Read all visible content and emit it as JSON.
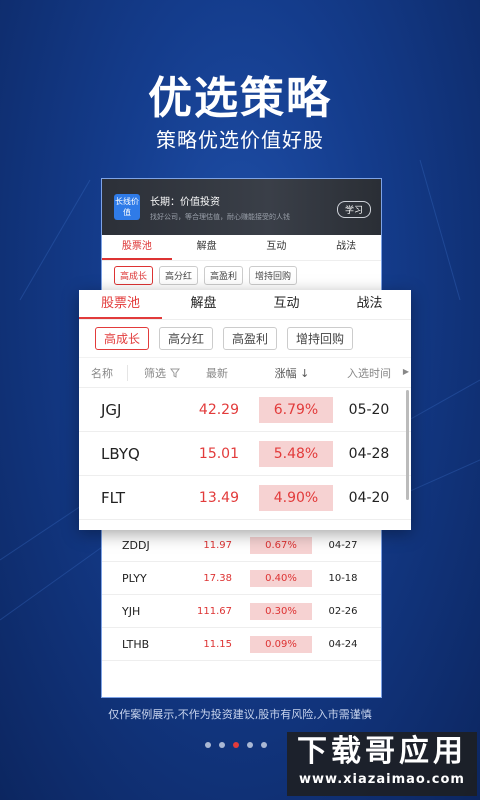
{
  "hero": {
    "title": "优选策略",
    "subtitle": "策略优选价值好股"
  },
  "banner": {
    "logo_text": "长线价值",
    "title": "长期：价值投资",
    "subtitle": "找好公司，等合理估值，耐心赚能接受的人钱",
    "button": "学习"
  },
  "tabs": [
    "股票池",
    "解盘",
    "互动",
    "战法"
  ],
  "chips": [
    "高成长",
    "高分红",
    "高盈利",
    "增持回购"
  ],
  "table": {
    "headers": {
      "name": "名称",
      "filter": "筛选",
      "price": "最新",
      "change": "涨幅",
      "date": "入选时间"
    },
    "rows": [
      {
        "code": "JGJ",
        "price": "42.29",
        "change": "6.79%",
        "date": "05-20"
      },
      {
        "code": "LBYQ",
        "price": "15.01",
        "change": "5.48%",
        "date": "04-28"
      },
      {
        "code": "FLT",
        "price": "13.49",
        "change": "4.90%",
        "date": "04-20"
      }
    ]
  },
  "phone_rows": [
    {
      "code": "ZDDJ",
      "price": "11.97",
      "change": "0.67%",
      "date": "04-27"
    },
    {
      "code": "PLYY",
      "price": "17.38",
      "change": "0.40%",
      "date": "10-18"
    },
    {
      "code": "YJH",
      "price": "111.67",
      "change": "0.30%",
      "date": "02-26"
    },
    {
      "code": "LTHB",
      "price": "11.15",
      "change": "0.09%",
      "date": "04-24"
    }
  ],
  "disclaimer": "仅作案例展示,不作为投资建议,股市有风险,入市需谨慎",
  "watermark": {
    "main": "下载哥应用",
    "url": "www.xiazaimao.com"
  },
  "colors": {
    "accent": "#e23b3b",
    "background": "#143c8c"
  },
  "icons": {
    "filter": "filter-icon",
    "sort": "sort-down-icon",
    "more": "chevron-right-icon"
  }
}
